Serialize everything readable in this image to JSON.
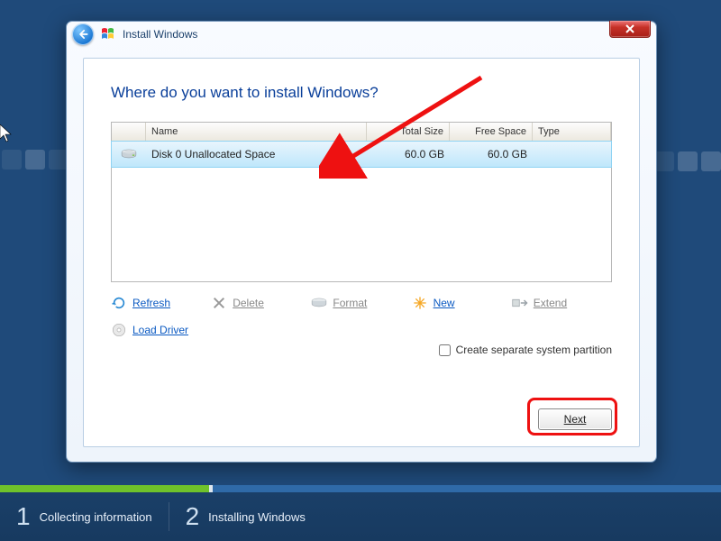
{
  "window": {
    "title": "Install Windows"
  },
  "heading": "Where do you want to install Windows?",
  "columns": {
    "name": "Name",
    "total": "Total Size",
    "free": "Free Space",
    "type": "Type"
  },
  "rows": [
    {
      "name": "Disk 0 Unallocated Space",
      "total": "60.0 GB",
      "free": "60.0 GB",
      "type": ""
    }
  ],
  "tools": {
    "refresh": "Refresh",
    "delete": "Delete",
    "format": "Format",
    "new": "New",
    "extend": "Extend",
    "load_driver": "Load Driver"
  },
  "checkbox_label": "Create separate system partition",
  "next_label": "Next",
  "steps": [
    {
      "num": "1",
      "label": "Collecting information"
    },
    {
      "num": "2",
      "label": "Installing Windows"
    }
  ],
  "progress": {
    "seg1_pct": 29,
    "seg1_color": "#6fc22b",
    "seg2_color": "#2f6aa8"
  }
}
